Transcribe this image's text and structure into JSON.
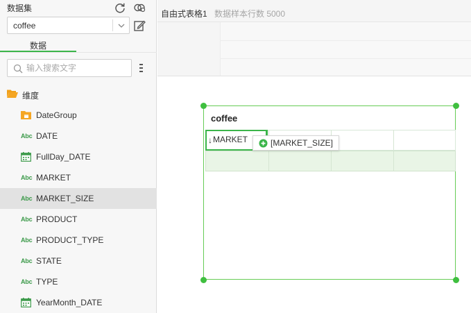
{
  "sidebar": {
    "dataset_label": "数据集",
    "dataset_value": "coffee",
    "tab_label": "数据",
    "search_placeholder": "输入搜索文字",
    "folder_label": "维度",
    "fields": [
      {
        "label": "DateGroup",
        "icon": "folder-date-icon"
      },
      {
        "label": "DATE",
        "icon": "abc-icon",
        "abc": "Abc"
      },
      {
        "label": "FullDay_DATE",
        "icon": "calendar-icon"
      },
      {
        "label": "MARKET",
        "icon": "abc-icon",
        "abc": "Abc"
      },
      {
        "label": "MARKET_SIZE",
        "icon": "abc-icon",
        "abc": "Abc",
        "selected": true
      },
      {
        "label": "PRODUCT",
        "icon": "abc-icon",
        "abc": "Abc"
      },
      {
        "label": "PRODUCT_TYPE",
        "icon": "abc-icon",
        "abc": "Abc"
      },
      {
        "label": "STATE",
        "icon": "abc-icon",
        "abc": "Abc"
      },
      {
        "label": "TYPE",
        "icon": "abc-icon",
        "abc": "Abc"
      },
      {
        "label": "YearMonth_DATE",
        "icon": "calendar-icon"
      }
    ]
  },
  "topbar": {
    "title": "自由式表格1",
    "subtitle": "数据样本行数 5000"
  },
  "widget": {
    "title": "coffee",
    "drop_cell_arrow": "↓",
    "drop_cell_text": "MARKET",
    "drag_tip": "[MARKET_SIZE]"
  },
  "colors": {
    "accent": "#3bb54a",
    "folder": "#f5a623"
  }
}
